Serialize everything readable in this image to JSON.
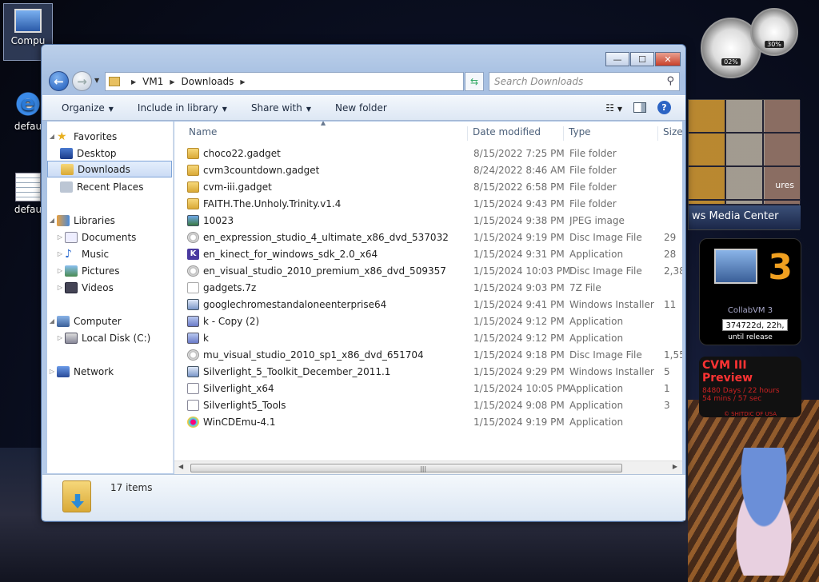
{
  "desktop": {
    "icons": [
      {
        "label": "Compu"
      },
      {
        "label": "defau"
      },
      {
        "label": "defau"
      }
    ],
    "gadgets": {
      "cpu_meter": {
        "cpu": "02%",
        "memory": "30%"
      },
      "media": {
        "label": "ws Media Center",
        "sub": "ures"
      },
      "collabvm": {
        "big": "3",
        "title": "CollabVM 3",
        "countdown": "374722d, 22h, 5",
        "caption": "until release"
      },
      "preview": {
        "title": "CVM III Preview",
        "line1": "8480 Days / 22 hours",
        "line2": "54 mins / 57 sec",
        "footer": "© SHITDIC OF USA"
      }
    }
  },
  "window": {
    "controls": {
      "minimize": "—",
      "maximize": "☐",
      "close": "✕"
    },
    "path": [
      "VM1",
      "Downloads"
    ],
    "search_placeholder": "Search Downloads",
    "toolbar": {
      "organize": "Organize",
      "include": "Include in library",
      "share": "Share with",
      "new_folder": "New folder"
    },
    "nav": {
      "favorites": "Favorites",
      "desktop": "Desktop",
      "downloads": "Downloads",
      "recent": "Recent Places",
      "libraries": "Libraries",
      "documents": "Documents",
      "music": "Music",
      "pictures": "Pictures",
      "videos": "Videos",
      "computer": "Computer",
      "local_disk": "Local Disk (C:)",
      "network": "Network"
    },
    "columns": {
      "name": "Name",
      "date": "Date modified",
      "type": "Type",
      "size": "Size"
    },
    "files": [
      {
        "name": "choco22.gadget",
        "date": "8/15/2022 7:25 PM",
        "type": "File folder",
        "size": "",
        "icon": "folder"
      },
      {
        "name": "cvm3countdown.gadget",
        "date": "8/24/2022 8:46 AM",
        "type": "File folder",
        "size": "",
        "icon": "folder"
      },
      {
        "name": "cvm-iii.gadget",
        "date": "8/15/2022 6:58 PM",
        "type": "File folder",
        "size": "",
        "icon": "folder"
      },
      {
        "name": "FAITH.The.Unholy.Trinity.v1.4",
        "date": "1/15/2024 9:43 PM",
        "type": "File folder",
        "size": "",
        "icon": "folder"
      },
      {
        "name": "10023",
        "date": "1/15/2024 9:38 PM",
        "type": "JPEG image",
        "size": "",
        "icon": "img"
      },
      {
        "name": "en_expression_studio_4_ultimate_x86_dvd_537032",
        "date": "1/15/2024 9:19 PM",
        "type": "Disc Image File",
        "size": "29",
        "icon": "disc"
      },
      {
        "name": "en_kinect_for_windows_sdk_2.0_x64",
        "date": "1/15/2024 9:31 PM",
        "type": "Application",
        "size": "28",
        "icon": "k"
      },
      {
        "name": "en_visual_studio_2010_premium_x86_dvd_509357",
        "date": "1/15/2024 10:03 PM",
        "type": "Disc Image File",
        "size": "2,38",
        "icon": "disc"
      },
      {
        "name": "gadgets.7z",
        "date": "1/15/2024 9:03 PM",
        "type": "7Z File",
        "size": "",
        "icon": "7z"
      },
      {
        "name": "googlechromestandaloneenterprise64",
        "date": "1/15/2024 9:41 PM",
        "type": "Windows Installer ...",
        "size": "11",
        "icon": "msi"
      },
      {
        "name": "k - Copy (2)",
        "date": "1/15/2024 9:12 PM",
        "type": "Application",
        "size": "",
        "icon": "char"
      },
      {
        "name": "k",
        "date": "1/15/2024 9:12 PM",
        "type": "Application",
        "size": "",
        "icon": "char"
      },
      {
        "name": "mu_visual_studio_2010_sp1_x86_dvd_651704",
        "date": "1/15/2024 9:18 PM",
        "type": "Disc Image File",
        "size": "1,55",
        "icon": "disc"
      },
      {
        "name": "Silverlight_5_Toolkit_December_2011.1",
        "date": "1/15/2024 9:29 PM",
        "type": "Windows Installer ...",
        "size": "5",
        "icon": "msi"
      },
      {
        "name": "Silverlight_x64",
        "date": "1/15/2024 10:05 PM",
        "type": "Application",
        "size": "1",
        "icon": "app"
      },
      {
        "name": "Silverlight5_Tools",
        "date": "1/15/2024 9:08 PM",
        "type": "Application",
        "size": "3",
        "icon": "app"
      },
      {
        "name": "WinCDEmu-4.1",
        "date": "1/15/2024 9:19 PM",
        "type": "Application",
        "size": "",
        "icon": "cd"
      }
    ],
    "status": "17 items"
  }
}
